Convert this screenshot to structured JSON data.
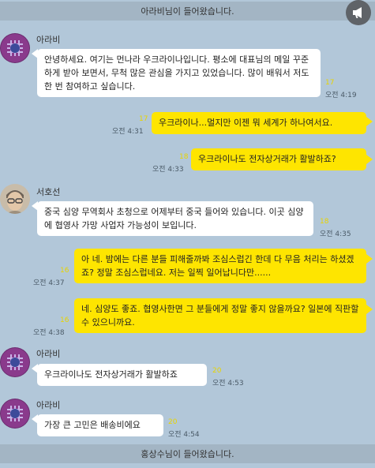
{
  "banner_top": "아라비님이 들어왔습니다.",
  "banner_bottom": "홍상수님이 들어왔습니다.",
  "messages": [
    {
      "sender": "아라비",
      "text": "안녕하세요. 여기는 먼나라 우크라이나입니다. 평소에 대표님의 메일 꾸준하게 받아 보면서, 무척 많은 관심을 가지고 있었습니다. 많이 배워서 저도 한 번 참여하고 싶습니다.",
      "unread": "17",
      "time": "오전 4:19"
    },
    {
      "text": "우크라이나...멀지만 이젠 뭐 세계가 하나여서요.",
      "unread": "17",
      "time": "오전 4:31"
    },
    {
      "text": "우크라이나도 전자상거래가 활발하죠?",
      "unread": "18",
      "time": "오전 4:33"
    },
    {
      "sender": "서호선",
      "text": "중국 심양 무역회사 초청으로 어제부터 중국 들어와 있습니다. 이곳 심양에 협영사 가망 사업자 가능성이 보입니다.",
      "unread": "18",
      "time": "오전 4:35"
    },
    {
      "text": "아 네. 밤에는 다른 분들 피해줄까봐 조심스럽긴 한데 다 무음 처리는 하셨겠죠? 정말 조심스럽네요. 저는 일찍 일어납니다만......",
      "unread": "16",
      "time": "오전 4:37"
    },
    {
      "text": "네. 심양도 좋죠. 협영사한면 그 분들에게 정말 좋지 않을까요? 일본에 직판할 수 있으니까요.",
      "unread": "16",
      "time": "오전 4:38"
    },
    {
      "sender": "아라비",
      "text": "우크라이나도 전자상거래가 활발하죠",
      "unread": "20",
      "time": "오전 4:53"
    },
    {
      "sender": "아라비",
      "text": "가장 큰 고민은 배송비에요",
      "unread": "20",
      "time": "오전 4:54"
    }
  ]
}
